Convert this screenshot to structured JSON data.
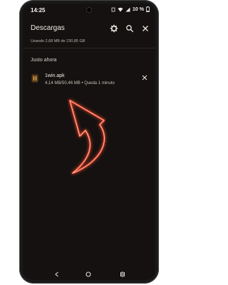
{
  "status_bar": {
    "time": "14:25",
    "battery": "10 %"
  },
  "app_bar": {
    "title": "Descargas",
    "icons": [
      "gear-icon",
      "search-icon",
      "close-icon"
    ]
  },
  "storage": {
    "usage_text": "Usando 2,68 MB de 230,85 GB"
  },
  "section": {
    "label": "Justo ahora"
  },
  "downloads": [
    {
      "name": "1win.apk",
      "progress_text": "4,14 MB/50,46 MB • Queda 1 minuto"
    }
  ],
  "overlay": {
    "arrow_color": "#e0442c"
  },
  "nav_bar": {
    "icons": [
      "back-icon",
      "home-icon",
      "recents-icon"
    ]
  }
}
